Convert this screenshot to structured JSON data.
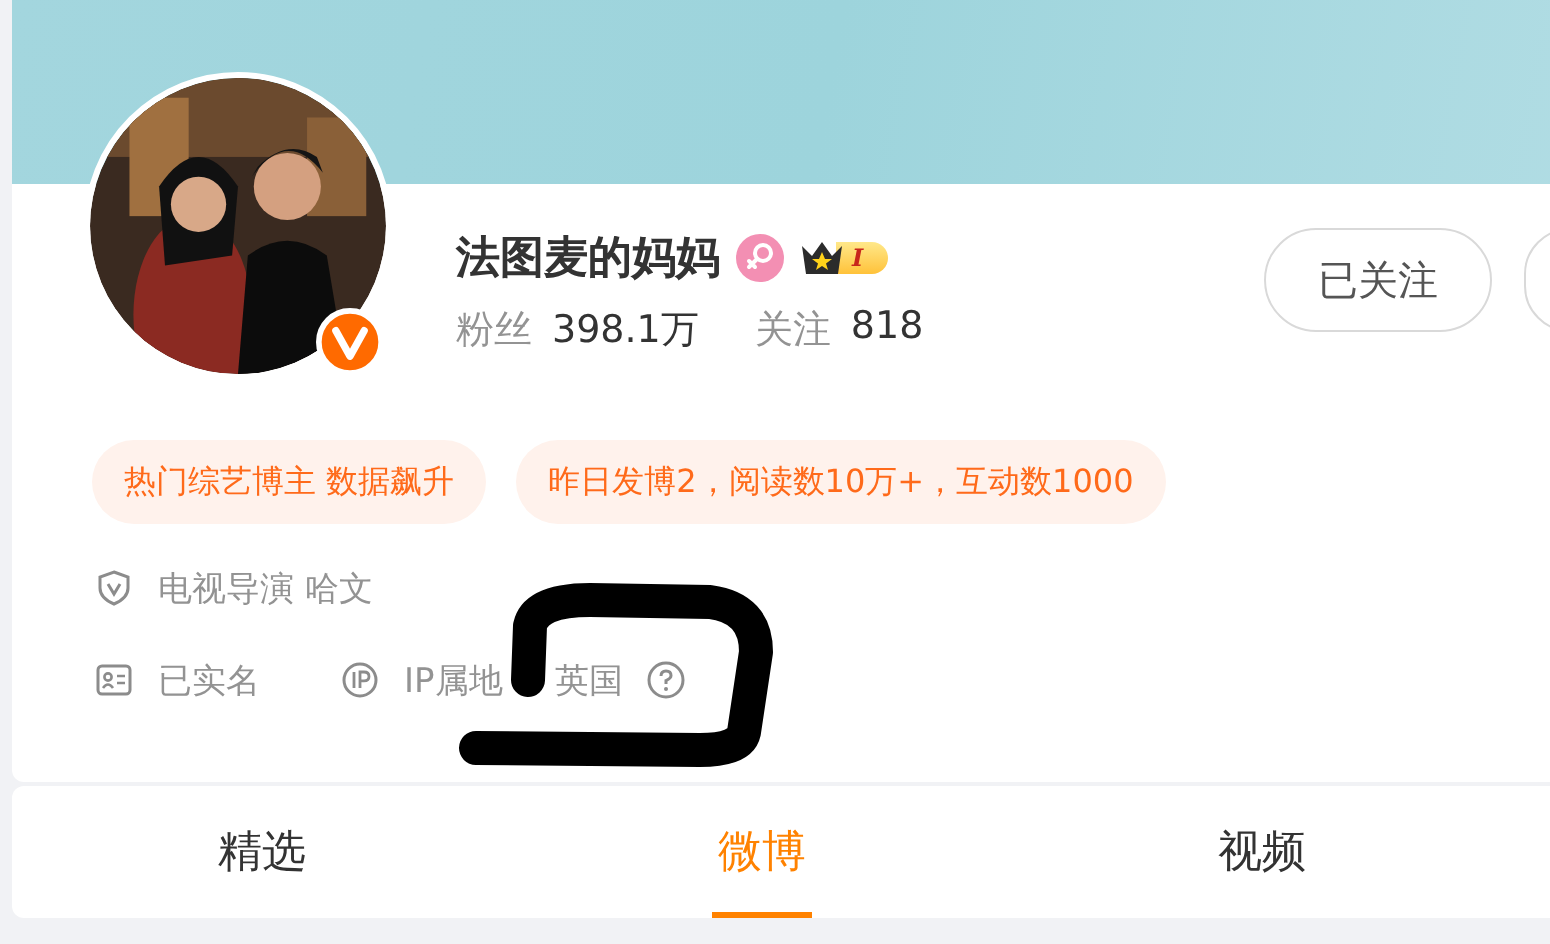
{
  "profile": {
    "name": "法图麦的妈妈",
    "rank_label": "I",
    "verified": true,
    "stats": [
      {
        "label": "粉丝",
        "value": "398.1万"
      },
      {
        "label": "关注",
        "value": "818"
      }
    ],
    "follow_button": "已关注"
  },
  "tags": [
    "热门综艺博主 数据飙升",
    "昨日发博2，阅读数10万+，互动数1000"
  ],
  "info_rows": [
    {
      "items": [
        {
          "kind": "shield",
          "text": "电视导演 哈文"
        }
      ]
    },
    {
      "items": [
        {
          "kind": "id-card",
          "text": "已实名"
        },
        {
          "kind": "ip",
          "text": "IP属地",
          "suffix": "英国",
          "help": true
        }
      ]
    }
  ],
  "tabs": [
    {
      "label": "精选",
      "selected": false
    },
    {
      "label": "微博",
      "selected": true
    },
    {
      "label": "视频",
      "selected": false
    }
  ]
}
